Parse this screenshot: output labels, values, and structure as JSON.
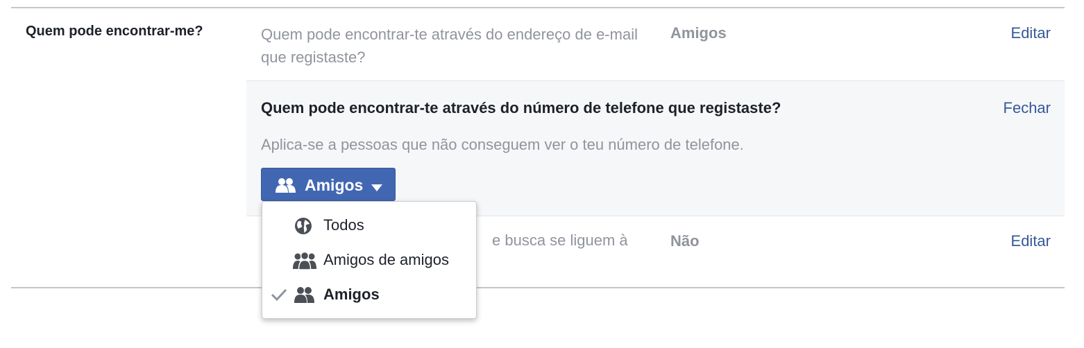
{
  "section": {
    "title": "Quem pode encontrar-me?"
  },
  "rows": {
    "email": {
      "description": "Quem pode encontrar-te através do endereço de e-mail que registaste?",
      "value": "Amigos",
      "edit_label": "Editar"
    },
    "search": {
      "description_partial_a": "e busca se liguem à",
      "value": "Não",
      "edit_label": "Editar"
    }
  },
  "expanded": {
    "title": "Quem pode encontrar-te através do número de telefone que registaste?",
    "close_label": "Fechar",
    "note": "Aplica-se a pessoas que não conseguem ver o teu número de telefone.",
    "audience_button_label": "Amigos"
  },
  "dropdown": {
    "items": [
      {
        "label": "Todos",
        "icon": "globe-icon",
        "selected": false
      },
      {
        "label": "Amigos de amigos",
        "icon": "friends-of-friends-icon",
        "selected": false
      },
      {
        "label": "Amigos",
        "icon": "friends-icon",
        "selected": true
      }
    ]
  },
  "colors": {
    "link": "#365899",
    "button_bg": "#4267b2",
    "muted_text": "#90949c",
    "expanded_bg": "#f6f7f9"
  }
}
